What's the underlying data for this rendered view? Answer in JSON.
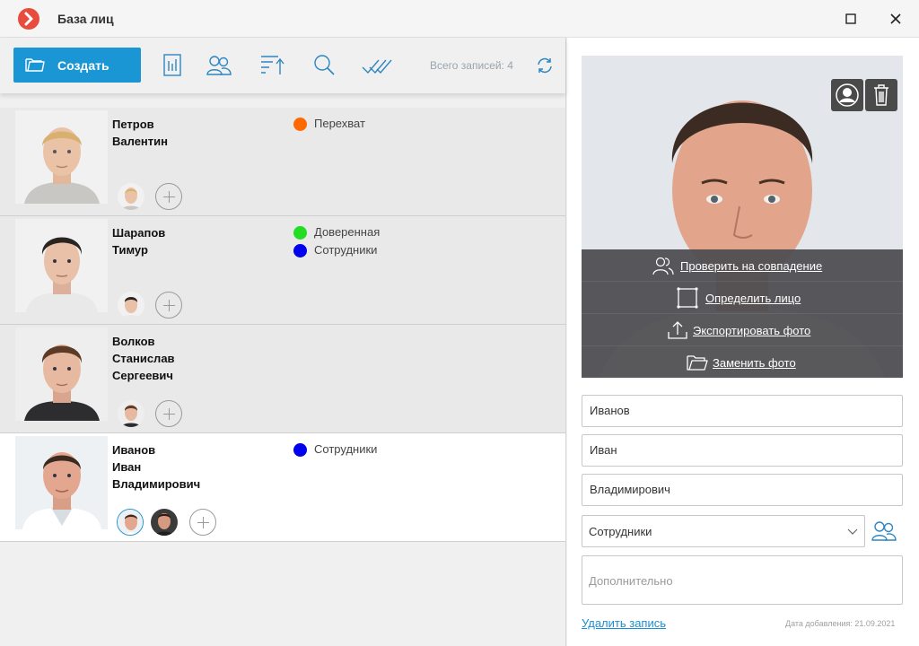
{
  "window": {
    "title": "База лиц",
    "brand_color": "#e84c3d",
    "controls": [
      "maximize-icon",
      "close-icon"
    ]
  },
  "toolbar": {
    "create_label": "Создать",
    "icons": [
      "report-icon",
      "lists-icon",
      "sort-icon",
      "search-icon",
      "select-all-icon"
    ],
    "total_label": "Всего записей: 4",
    "accent": "#1b96d4"
  },
  "faces": [
    {
      "surname": "Петров",
      "name": "Валентин",
      "patronymic": "",
      "tags": [
        {
          "label": "Перехват",
          "color": "#ff6a00"
        }
      ],
      "thumbs": 1,
      "selected": false
    },
    {
      "surname": "Шарапов",
      "name": "Тимур",
      "patronymic": "",
      "tags": [
        {
          "label": "Доверенная",
          "color": "#22dd22"
        },
        {
          "label": "Сотрудники",
          "color": "#0000ee"
        }
      ],
      "thumbs": 1,
      "selected": false
    },
    {
      "surname": "Волков",
      "name": "Станислав",
      "patronymic": "Сергеевич",
      "tags": [],
      "thumbs": 1,
      "selected": false
    },
    {
      "surname": "Иванов",
      "name": "Иван",
      "patronymic": "Владимирович",
      "tags": [
        {
          "label": "Сотрудники",
          "color": "#0000ee"
        }
      ],
      "thumbs": 2,
      "selected": true
    }
  ],
  "details": {
    "photo_actions": {
      "check": "Проверить на совпадение",
      "detect": "Определить лицо",
      "export": "Экспортировать фото",
      "replace": "Заменить фото"
    },
    "surname": "Иванов",
    "name": "Иван",
    "patronymic": "Владимирович",
    "list": "Сотрудники",
    "extra_placeholder": "Дополнительно",
    "delete_label": "Удалить запись",
    "date_added": "Дата добавления: 21.09.2021"
  }
}
